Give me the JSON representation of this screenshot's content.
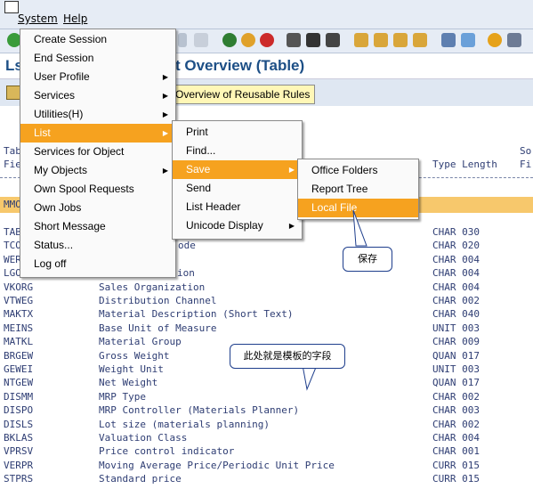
{
  "menubar": {
    "system": "System",
    "help": "Help"
  },
  "title": {
    "left": "Ls",
    "text": "t Overview (Table)"
  },
  "app_toolbar": {
    "reusable_button": "Overview of Reusable Rules"
  },
  "list_headers": {
    "col1_top": "Tab",
    "col1_bottom": "Fie",
    "type_length": "Type Length",
    "right_top": "So",
    "right_bottom": "Fi"
  },
  "highlight_row_key": "MMO",
  "rows": [
    {
      "key": "TAB",
      "desc": "",
      "type": "CHAR 030"
    },
    {
      "key": "TCO",
      "desc": "ode",
      "type": "CHAR 020"
    },
    {
      "key": "WER",
      "desc": "",
      "type": "CHAR 004"
    },
    {
      "key": "LGO",
      "desc": "ion",
      "type": "CHAR 004"
    },
    {
      "key": "VKORG",
      "desc": "Sales Organization",
      "type": "CHAR 004"
    },
    {
      "key": "VTWEG",
      "desc": "Distribution Channel",
      "type": "CHAR 002"
    },
    {
      "key": "MAKTX",
      "desc": "Material Description (Short Text)",
      "type": "CHAR 040"
    },
    {
      "key": "MEINS",
      "desc": "Base Unit of Measure",
      "type": "UNIT 003"
    },
    {
      "key": "MATKL",
      "desc": "Material Group",
      "type": "CHAR 009"
    },
    {
      "key": "BRGEW",
      "desc": "Gross Weight",
      "type": "QUAN 017"
    },
    {
      "key": "GEWEI",
      "desc": "Weight Unit",
      "type": "UNIT 003"
    },
    {
      "key": "NTGEW",
      "desc": "Net Weight",
      "type": "QUAN 017"
    },
    {
      "key": "DISMM",
      "desc": "MRP Type",
      "type": "CHAR 002"
    },
    {
      "key": "DISPO",
      "desc": "MRP Controller (Materials Planner)",
      "type": "CHAR 003"
    },
    {
      "key": "DISLS",
      "desc": "Lot size (materials planning)",
      "type": "CHAR 002"
    },
    {
      "key": "BKLAS",
      "desc": "Valuation Class",
      "type": "CHAR 004"
    },
    {
      "key": "VPRSV",
      "desc": "Price control indicator",
      "type": "CHAR 001"
    },
    {
      "key": "VERPR",
      "desc": "Moving Average Price/Periodic Unit Price",
      "type": "CURR 015"
    },
    {
      "key": "STPRS",
      "desc": "Standard price",
      "type": "CURR 015"
    }
  ],
  "system_menu": [
    {
      "label": "Create Session",
      "submenu": false
    },
    {
      "label": "End Session",
      "submenu": false
    },
    {
      "label": "User Profile",
      "submenu": true
    },
    {
      "label": "Services",
      "submenu": true
    },
    {
      "label": "Utilities(H)",
      "submenu": true
    },
    {
      "label": "List",
      "submenu": true
    },
    {
      "label": "Services for Object",
      "submenu": false
    },
    {
      "label": "My Objects",
      "submenu": true
    },
    {
      "label": "Own Spool Requests",
      "submenu": false
    },
    {
      "label": "Own Jobs",
      "submenu": false
    },
    {
      "label": "Short Message",
      "submenu": false
    },
    {
      "label": "Status...",
      "submenu": false
    },
    {
      "label": "Log off",
      "submenu": false
    }
  ],
  "list_menu": [
    {
      "label": "Print",
      "submenu": false
    },
    {
      "label": "Find...",
      "submenu": false
    },
    {
      "label": "Save",
      "submenu": true
    },
    {
      "label": "Send",
      "submenu": false
    },
    {
      "label": "List Header",
      "submenu": false
    },
    {
      "label": "Unicode Display",
      "submenu": true
    }
  ],
  "save_menu": [
    {
      "label": "Office Folders"
    },
    {
      "label": "Report Tree"
    },
    {
      "label": "Local File"
    }
  ],
  "callouts": {
    "save_note": "保存",
    "template_note": "此处就是模板的字段"
  },
  "colors": {
    "highlight": "#f6a21f",
    "title": "#1d4f86",
    "list_text": "#2e3d73"
  }
}
